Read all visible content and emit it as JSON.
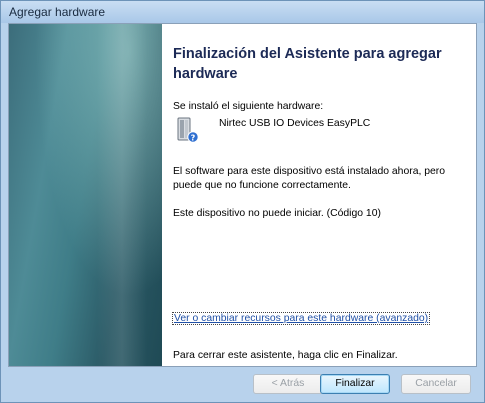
{
  "window": {
    "title": "Agregar hardware"
  },
  "main": {
    "heading": "Finalización del Asistente para agregar hardware",
    "installed_label": "Se instaló el siguiente hardware:",
    "device": {
      "name": "Nirtec USB IO Devices EasyPLC",
      "icon": "device-unknown-icon"
    },
    "software_message": "El software para este dispositivo está instalado ahora, pero puede que no funcione correctamente.",
    "error_message": "Este dispositivo no puede iniciar. (Código 10)",
    "advanced_link": "Ver o cambiar recursos para este hardware (avanzado)",
    "close_hint": "Para cerrar este asistente, haga clic en Finalizar."
  },
  "buttons": {
    "back": "< Atrás",
    "finish": "Finalizar",
    "cancel": "Cancelar"
  },
  "colors": {
    "heading": "#1c2a56",
    "link": "#2050a6",
    "side_panel": "#3f7d88",
    "frame": "#b8d2ec"
  }
}
